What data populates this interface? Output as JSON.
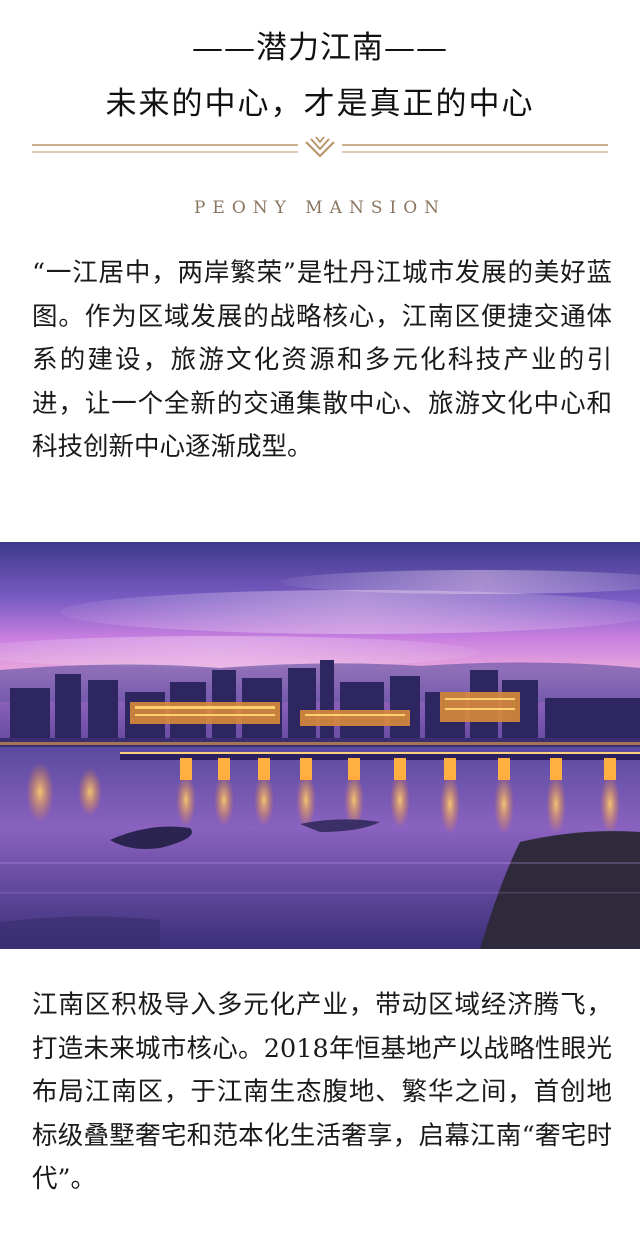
{
  "header": {
    "title_line1": "——潜力江南——",
    "title_line2": "未来的中心，才是真正的中心",
    "brand": "PEONY MANSION"
  },
  "paragraphs": {
    "p1": "“一江居中，两岸繁荣”是牡丹江城市发展的美好蓝图。作为区域发展的战略核心，江南区便捷交通体系的建设，旅游文化资源和多元化科技产业的引进，让一个全新的交通集散中心、旅游文化中心和科技创新中心逐渐成型。",
    "p2": "江南区积极导入多元化产业，带动区域经济腾飞，打造未来城市核心。2018年恒基地产以战略性眼光布局江南区，于江南生态腹地、繁华之间，首创地标级叠墅奢宅和范本化生活奢享，启幕江南“奢宅时代”。"
  },
  "colors": {
    "gold": "#b8966a",
    "brand_text": "#8a7660",
    "sky_top": "#4b3a8e",
    "sky_mid": "#b56ad0",
    "water": "#6b4ca8",
    "lights": "#ffb040"
  },
  "image": {
    "subject": "night-river-city-bridge-photo"
  }
}
